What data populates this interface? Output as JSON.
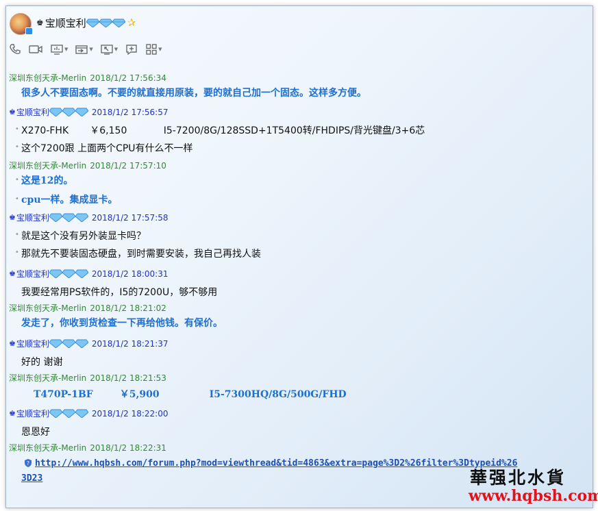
{
  "contact": {
    "name": "宝顺宝利"
  },
  "toolbar": [
    {
      "name": "phone-icon"
    },
    {
      "name": "video-icon"
    },
    {
      "name": "screen-share-icon"
    },
    {
      "name": "transfer-file-icon"
    },
    {
      "name": "remote-desktop-icon"
    },
    {
      "name": "add-app-icon"
    },
    {
      "name": "apps-grid-icon"
    }
  ],
  "messages": [
    {
      "sender": "深圳东创天承-Merlin",
      "time": "2018/1/2 17:56:34",
      "lines": [
        "很多人不要固态啊。不要的就直接用原装，要的就自己加一个固态。这样多方便。"
      ]
    },
    {
      "sender": "宝顺宝利",
      "time": "2018/1/2 17:56:57",
      "lines": [
        "X270-FHK       ￥6,150            I5-7200/8G/128SSD+1T5400转/FHDIPS/背光键盘/3+6芯",
        "这个7200跟 上面两个CPU有什么不一样"
      ]
    },
    {
      "sender": "深圳东创天承-Merlin",
      "time": "2018/1/2 17:57:10",
      "lines": [
        "这是12的。",
        "cpu一样。集成显卡。"
      ]
    },
    {
      "sender": "宝顺宝利",
      "time": "2018/1/2 17:57:58",
      "lines": [
        "就是这个没有另外装显卡吗？",
        "那就先不要装固态硬盘，到时需要安装，我自己再找人装"
      ]
    },
    {
      "sender": "宝顺宝利",
      "time": "2018/1/2 18:00:31",
      "lines": [
        "我要经常用PS软件的，I5的7200U，够不够用"
      ]
    },
    {
      "sender": "深圳东创天承-Merlin",
      "time": "2018/1/2 18:21:02",
      "lines": [
        "发走了，你收到货检查一下再给他钱。有保价。"
      ]
    },
    {
      "sender": "宝顺宝利",
      "time": "2018/1/2 18:21:37",
      "lines": [
        "好的 谢谢"
      ]
    },
    {
      "sender": "深圳东创天承-Merlin",
      "time": "2018/1/2 18:21:53",
      "lines": [
        "T470P-1BF        ￥5,900               I5-7300HQ/8G/500G/FHD"
      ]
    },
    {
      "sender": "宝顺宝利",
      "time": "2018/1/2 18:22:00",
      "lines": [
        "恩恩好"
      ]
    },
    {
      "sender": "深圳东创天承-Merlin",
      "time": "2018/1/2 18:22:31",
      "lines": [
        "http://www.hqbsh.com/forum.php?mod=viewthread&tid=4863&extra=page%3D2%26filter%3Dtypeid%26",
        "3D23"
      ]
    }
  ],
  "watermark": {
    "line1": "華强北水貨",
    "line2": "www.hqbsh.com"
  },
  "colors": {
    "sender_merlin": "#2e8b2e",
    "sender_user": "#1e32c8",
    "merlin_text": "#1e6fcf",
    "link": "#1c4fb5",
    "watermark_url": "#e0121c"
  }
}
